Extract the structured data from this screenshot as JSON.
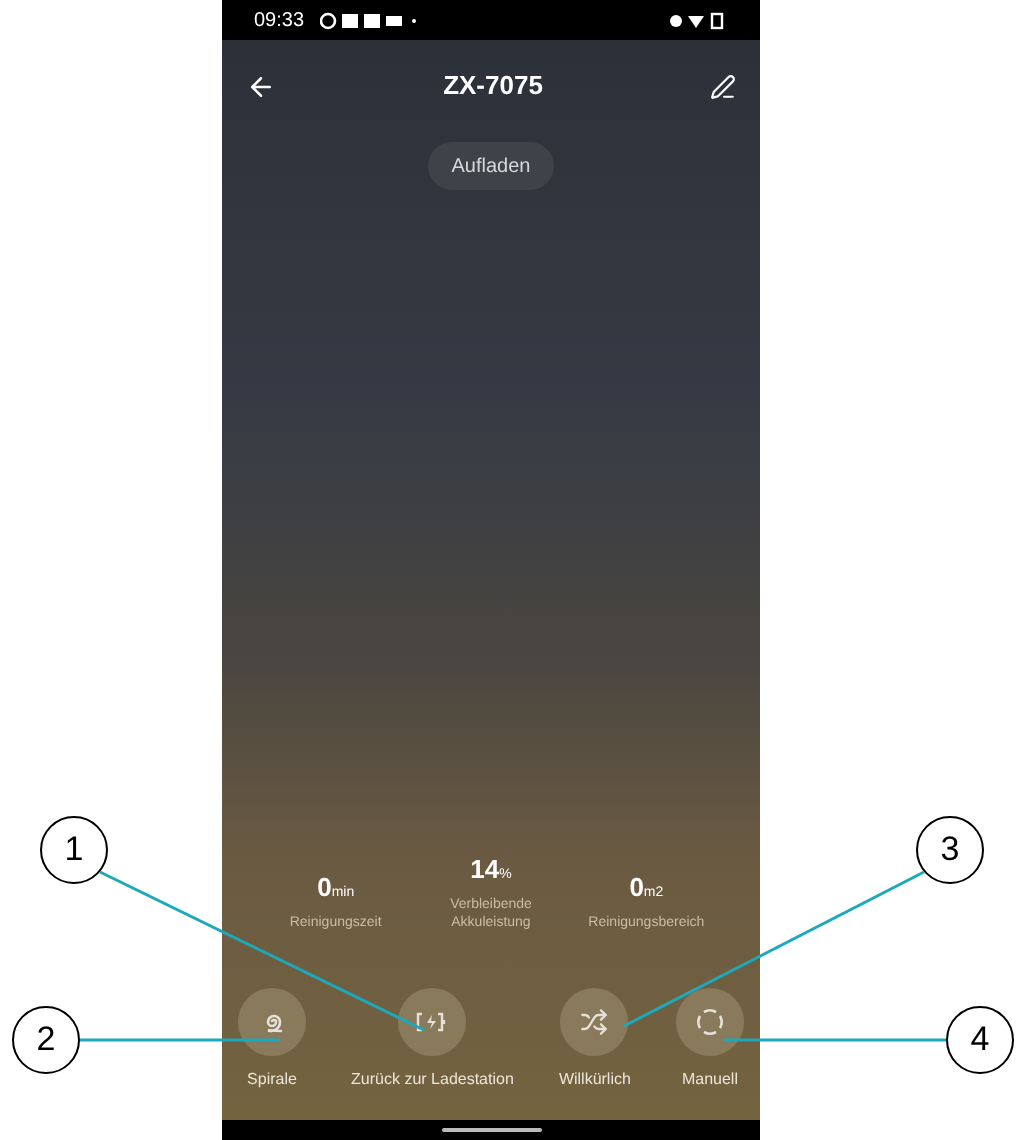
{
  "status_bar": {
    "time": "09:33"
  },
  "header": {
    "title": "ZX-7075"
  },
  "charge_button": {
    "label": "Aufladen"
  },
  "stats": [
    {
      "value": "0",
      "unit": "min",
      "label": "Reinigungszeit"
    },
    {
      "value": "14",
      "unit": "%",
      "label": "Verbleibende Akkuleistung"
    },
    {
      "value": "0",
      "unit": "m2",
      "label": "Reinigungsbereich"
    }
  ],
  "modes": [
    {
      "kind": "spiral",
      "label": "Spirale"
    },
    {
      "kind": "dock",
      "label": "Zurück zur Ladestation"
    },
    {
      "kind": "random",
      "label": "Willkürlich"
    },
    {
      "kind": "manual",
      "label": "Manuell"
    }
  ],
  "callouts": [
    {
      "label": "1"
    },
    {
      "label": "2"
    },
    {
      "label": "3"
    },
    {
      "label": "4"
    }
  ]
}
